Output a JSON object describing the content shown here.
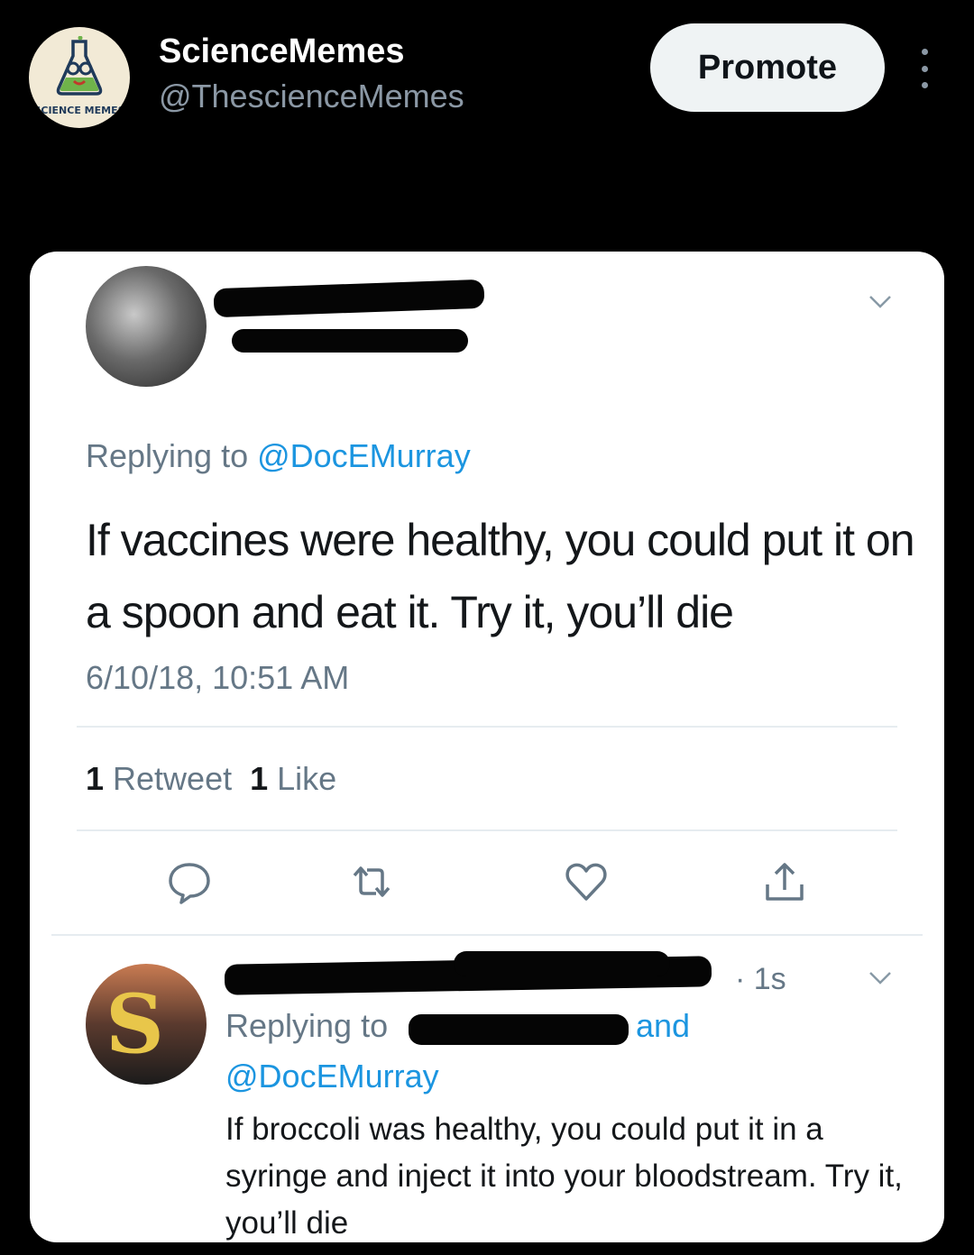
{
  "post": {
    "account_name": "ScienceMemes",
    "account_handle": "@ThescienceMemes",
    "avatar_logo_text": "SCIENCE MEMES",
    "promote_label": "Promote",
    "more_icon": "more-vertical-icon"
  },
  "screenshot": {
    "tweet": {
      "replying_prefix": "Replying to ",
      "replying_mention": "@DocEMurray",
      "text": "If vaccines were healthy, you could put it on a spoon and eat it. Try it, you’ll die",
      "timestamp": "6/10/18, 10:51 AM",
      "retweet_count": "1",
      "retweet_label": " Retweet",
      "like_count": "1",
      "like_label": " Like",
      "icons": [
        "reply-icon",
        "retweet-icon",
        "like-icon",
        "share-icon"
      ]
    },
    "reply": {
      "time": "· 1s",
      "replying_prefix": "Replying to",
      "and_label": "and",
      "mention": "@DocEMurray",
      "text": "If broccoli was healthy, you could put it in a syringe and inject it into your bloodstream. Try it, you’ll die"
    }
  },
  "colors": {
    "background": "#000000",
    "card": "#ffffff",
    "link": "#1b95e0",
    "muted": "#657786",
    "promote_bg": "#eff3f4"
  }
}
